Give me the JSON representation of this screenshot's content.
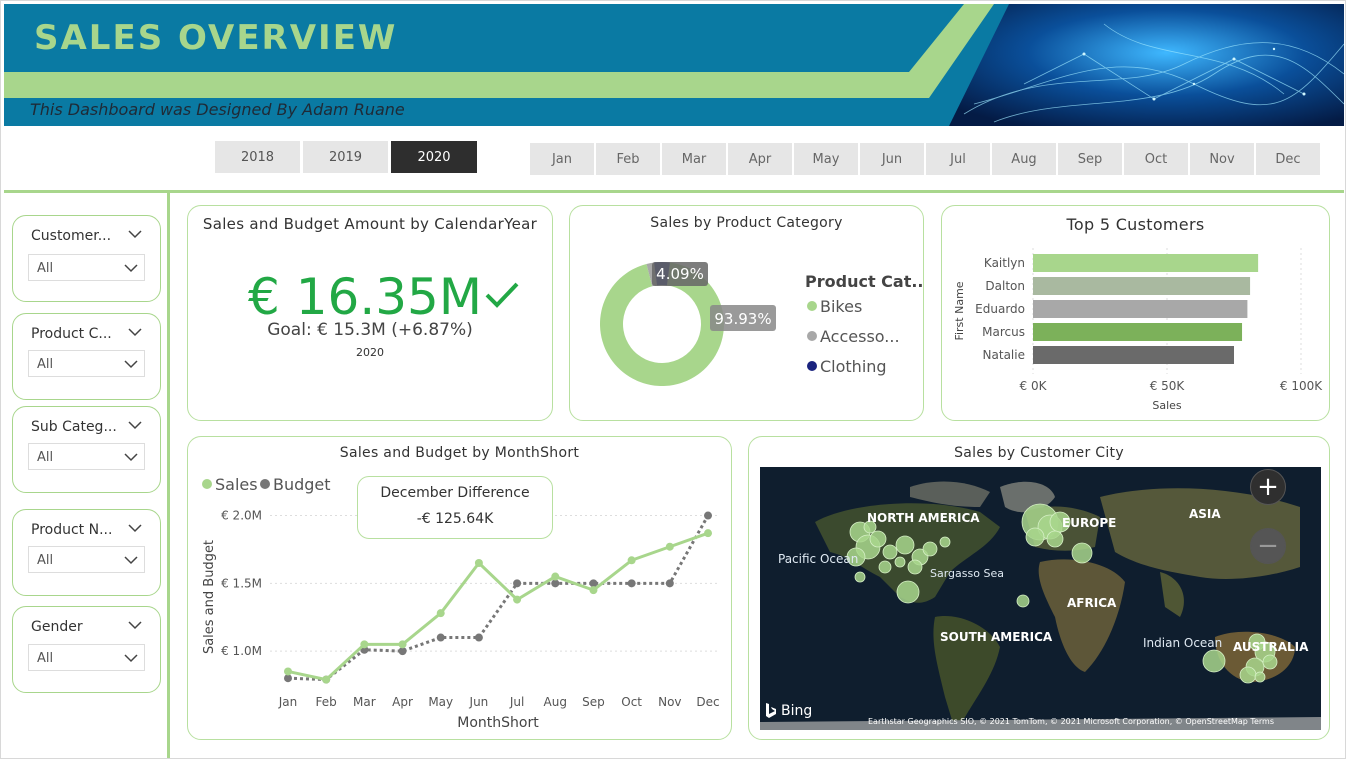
{
  "header": {
    "title": "SALES OVERVIEW",
    "subtitle": "This Dashboard was Designed By Adam Ruane"
  },
  "year_slicer": [
    "2018",
    "2019",
    "2020"
  ],
  "year_selected": "2020",
  "month_slicer": [
    "Jan",
    "Feb",
    "Mar",
    "Apr",
    "May",
    "Jun",
    "Jul",
    "Aug",
    "Sep",
    "Oct",
    "Nov",
    "Dec"
  ],
  "filters": [
    {
      "title": "Customer...",
      "value": "All"
    },
    {
      "title": "Product C...",
      "value": "All"
    },
    {
      "title": "Sub Categ...",
      "value": "All"
    },
    {
      "title": "Product N...",
      "value": "All"
    },
    {
      "title": "Gender",
      "value": "All"
    }
  ],
  "kpi": {
    "title": "Sales and Budget Amount by CalendarYear",
    "value": "€ 16.35M",
    "goal": "Goal: € 15.3M (+6.87%)",
    "year": "2020",
    "check_icon": "checkmark-icon"
  },
  "colors": {
    "accent_green": "#a8d68c",
    "kpi_green": "#22a845",
    "banner_blue": "#0a7aa3",
    "budget_gray": "#777777",
    "clothing_navy": "#1a237e"
  },
  "donut": {
    "title": "Sales by Product Category",
    "legend_title": "Product Cat...",
    "legend": [
      "Bikes",
      "Accesso...",
      "Clothing"
    ],
    "label_small": "4.09%",
    "label_large": "93.93%"
  },
  "top5": {
    "title": "Top 5 Customers",
    "xlabel": "Sales",
    "ylabel": "First Name",
    "ticks": [
      "€ 0K",
      "€ 50K",
      "€ 100K"
    ]
  },
  "line": {
    "title": "Sales and Budget by MonthShort",
    "legend": [
      "Sales",
      "Budget"
    ],
    "ylabel": "Sales and Budget",
    "xlabel": "MonthShort",
    "yticks": [
      "€ 2.0M",
      "€ 1.5M",
      "€ 1.0M"
    ],
    "callout_title": "December Difference",
    "callout_value": "-€ 125.64K"
  },
  "map": {
    "title": "Sales by Customer City",
    "labels": {
      "north_america": "NORTH AMERICA",
      "europe": "EUROPE",
      "asia": "ASIA",
      "africa": "AFRICA",
      "south_america": "SOUTH AMERICA",
      "australia": "AUSTRALIA",
      "pacific": "Pacific Ocean",
      "indian": "Indian Ocean",
      "sargasso": "Sargasso Sea"
    },
    "bing": "Bing",
    "credit": "Earthstar Geographics SIO, © 2021 TomTom, © 2021 Microsoft Corporation, © OpenStreetMap  Terms",
    "zoom_in": "+",
    "zoom_out": "−"
  },
  "chart_data": [
    {
      "type": "pie",
      "title": "Sales by Product Category",
      "categories": [
        "Bikes",
        "Accessories",
        "Clothing"
      ],
      "values": [
        93.93,
        1.98,
        4.09
      ],
      "colors": [
        "#a8d68c",
        "#a8a8a8",
        "#1a237e"
      ]
    },
    {
      "type": "bar",
      "title": "Top 5 Customers",
      "categories": [
        "Kaitlyn",
        "Dalton",
        "Eduardo",
        "Marcus",
        "Natalie"
      ],
      "values": [
        84,
        81,
        80,
        78,
        75
      ],
      "colors": [
        "#a8d68c",
        "#a9b9a0",
        "#a8a8a8",
        "#7cb15a",
        "#6a6a6a"
      ],
      "xlabel": "Sales",
      "ylabel": "First Name",
      "xlim": [
        0,
        100
      ]
    },
    {
      "type": "line",
      "title": "Sales and Budget by MonthShort",
      "categories": [
        "Jan",
        "Feb",
        "Mar",
        "Apr",
        "May",
        "Jun",
        "Jul",
        "Aug",
        "Sep",
        "Oct",
        "Nov",
        "Dec"
      ],
      "series": [
        {
          "name": "Sales",
          "values": [
            0.85,
            0.79,
            1.05,
            1.05,
            1.28,
            1.65,
            1.38,
            1.55,
            1.45,
            1.67,
            1.77,
            1.87
          ]
        },
        {
          "name": "Budget",
          "values": [
            0.8,
            0.79,
            1.01,
            1.0,
            1.1,
            1.1,
            1.5,
            1.5,
            1.5,
            1.5,
            1.5,
            2.0
          ]
        }
      ],
      "xlabel": "MonthShort",
      "ylabel": "Sales and Budget",
      "ylim": [
        0.75,
        2.1
      ]
    }
  ]
}
